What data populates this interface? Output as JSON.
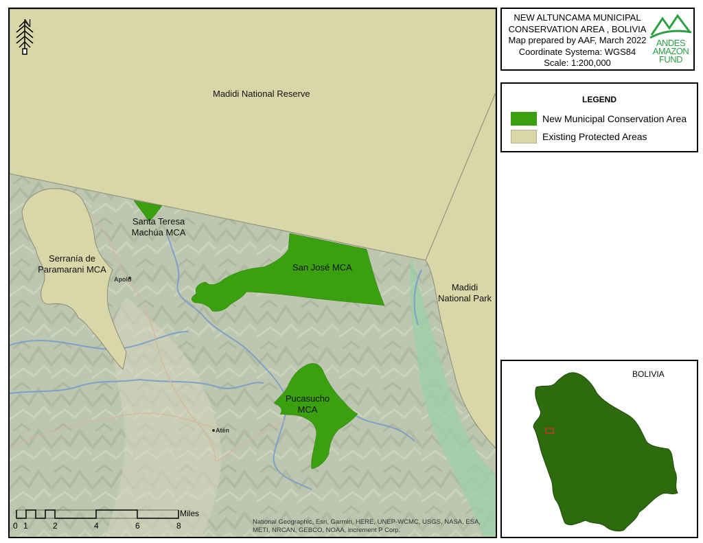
{
  "title": {
    "lines": [
      "NEW ALTUNCAMA MUNICIPAL",
      "CONSERVATION AREA , BOLIVIA",
      "Map prepared by AAF, March 2022",
      "Coordinate Systema: WGS84",
      "Scale: 1:200,000"
    ]
  },
  "logo": {
    "line1": "ANDES",
    "line2": "AMAZON",
    "line3": "FUND"
  },
  "legend": {
    "title": "LEGEND",
    "items": [
      {
        "label": "New Municipal Conservation Area",
        "color": "#3aa010"
      },
      {
        "label": "Existing Protected Areas",
        "color": "#d9d6a8"
      }
    ]
  },
  "north": "N",
  "map_labels": {
    "madidi_reserve": "Madidi National Reserve",
    "santa_teresa_1": "Santa Teresa",
    "santa_teresa_2": "Machúa MCA",
    "serrania_1": "Serranía de",
    "serrania_2": "Paramarani MCA",
    "san_jose": "San José MCA",
    "madidi_park_1": "Madidi",
    "madidi_park_2": "National Park",
    "pucasucho_1": "Pucasucho",
    "pucasucho_2": "MCA",
    "apolo": "Apolo",
    "aten": "Atén"
  },
  "scale_bar": {
    "unit": "Miles",
    "ticks": [
      "0",
      "1",
      "2",
      "4",
      "6",
      "8"
    ]
  },
  "attribution": "National Geographic, Esri, Garmin, HERE, UNEP-WCMC, USGS, NASA, ESA, METI, NRCAN, GEBCO, NOAA, increment P Corp.",
  "inset": {
    "label": "BOLIVIA",
    "country_color": "#2e6b0e",
    "locator_color": "#c0392b"
  },
  "colors": {
    "mca_green": "#3aa010",
    "protected_area": "#d9d6a8",
    "terrain": "#b9c4ac",
    "river": "#7fa0c8"
  }
}
